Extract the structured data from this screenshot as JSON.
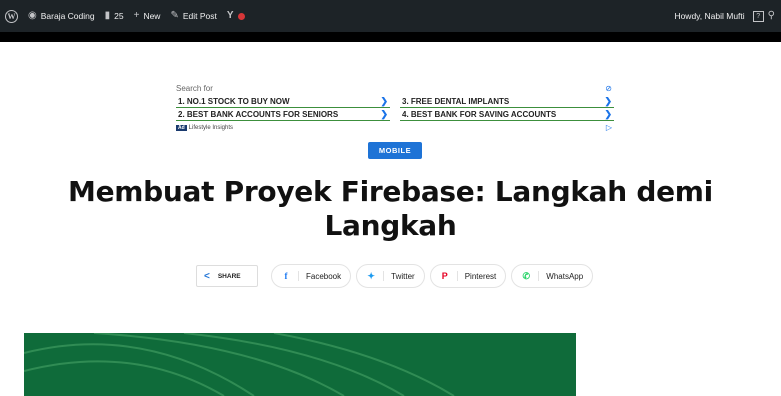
{
  "adminbar": {
    "site_name": "Baraja Coding",
    "comments_count": "25",
    "new_label": "New",
    "edit_post_label": "Edit Post",
    "howdy": "Howdy, Nabil Mufti",
    "avatar_glyph": "?"
  },
  "ad": {
    "search_for": "Search for",
    "links": [
      {
        "text": "1. NO.1 STOCK TO BUY NOW"
      },
      {
        "text": "3. FREE DENTAL IMPLANTS"
      },
      {
        "text": "2. BEST BANK ACCOUNTS FOR SENIORS"
      },
      {
        "text": "4. BEST BANK FOR SAVING ACCOUNTS"
      }
    ],
    "badge": "Ad",
    "sponsor": "Lifestyle Insights"
  },
  "category": "MOBILE",
  "title_line1": "Membuat Proyek Firebase: Langkah demi",
  "title_line2": "Langkah",
  "share": {
    "label": "SHARE",
    "buttons": [
      {
        "label": "Facebook",
        "icon": "facebook-icon"
      },
      {
        "label": "Twitter",
        "icon": "twitter-icon"
      },
      {
        "label": "Pinterest",
        "icon": "pinterest-icon"
      },
      {
        "label": "WhatsApp",
        "icon": "whatsapp-icon"
      }
    ]
  },
  "colors": {
    "adminbar_bg": "#1d2327",
    "category_bg": "#1e73d6",
    "featured_bg": "#0f6b3a"
  }
}
